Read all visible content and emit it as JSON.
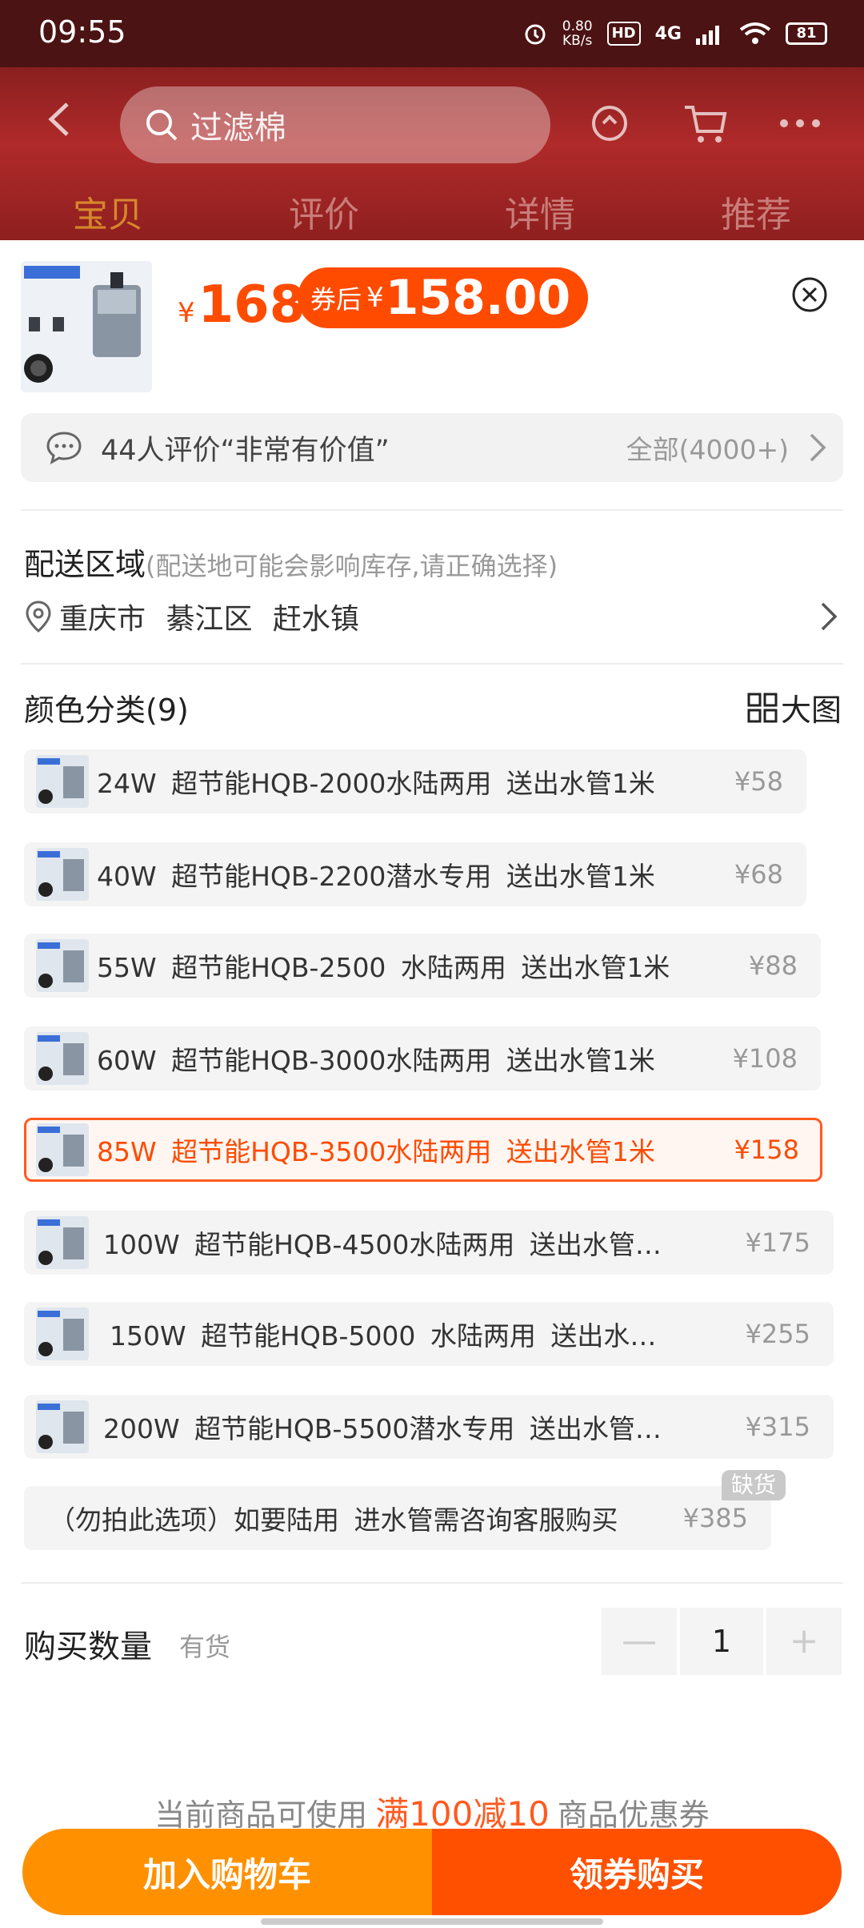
{
  "status_bar": {
    "time": "09:55",
    "net_speed_value": "0.80",
    "net_speed_unit": "KB/s",
    "hd": "HD",
    "network": "4G",
    "battery": "81",
    "icons": [
      "alarm-icon",
      "signal-icon",
      "wifi-icon",
      "battery-icon"
    ]
  },
  "topnav": {
    "search_text": "过滤棉",
    "icons": [
      "back-icon",
      "search-icon",
      "refresh-icon",
      "cart-icon",
      "more-icon"
    ]
  },
  "tabs": [
    "宝贝",
    "评价",
    "详情",
    "推荐"
  ],
  "product": {
    "price_symbol": "¥",
    "price": "168",
    "coupon_label": "券后",
    "coupon_symbol": "¥",
    "coupon_price": "158.00"
  },
  "review": {
    "text": "44人评价“非常有价值”",
    "all": "全部(4000+)"
  },
  "delivery": {
    "title": "配送区域",
    "hint": "(配送地可能会影响库存,请正确选择)",
    "address": "重庆市 綦江区 赶水镇"
  },
  "color": {
    "title": "颜色分类(9)",
    "big_view": "大图"
  },
  "skus": [
    {
      "label": "24W  超节能HQB-2000水陆两用  送出水管1米",
      "price": "¥58"
    },
    {
      "label": "40W  超节能HQB-2200潜水专用  送出水管1米",
      "price": "¥68"
    },
    {
      "label": "55W  超节能HQB-2500  水陆两用  送出水管1米",
      "price": "¥88"
    },
    {
      "label": "60W  超节能HQB-3000水陆两用  送出水管1米",
      "price": "¥108"
    },
    {
      "label": "85W  超节能HQB-3500水陆两用  送出水管1米",
      "price": "¥158"
    },
    {
      "label": "100W  超节能HQB-4500水陆两用  送出水管…",
      "price": "¥175"
    },
    {
      "label": "150W  超节能HQB-5000  水陆两用  送出水…",
      "price": "¥255"
    },
    {
      "label": "200W  超节能HQB-5500潜水专用  送出水管…",
      "price": "¥315"
    },
    {
      "label": "（勿拍此选项）如要陆用  进水管需咨询客服购买",
      "price": "¥385"
    }
  ],
  "oos_badge": "缺货",
  "quantity": {
    "label": "购买数量",
    "stock": "有货",
    "minus": "—",
    "value": "1",
    "plus": "+"
  },
  "promo": {
    "prefix": "当前商品可使用",
    "highlight": "满100减10",
    "suffix": "商品优惠券"
  },
  "actions": {
    "cart": "加入购物车",
    "buy": "领券购买"
  },
  "colors": {
    "accent": "#ff4b00",
    "cart_button": "#ff9100",
    "buy_button": "#ff5000",
    "dim_header": "#8c2020"
  }
}
